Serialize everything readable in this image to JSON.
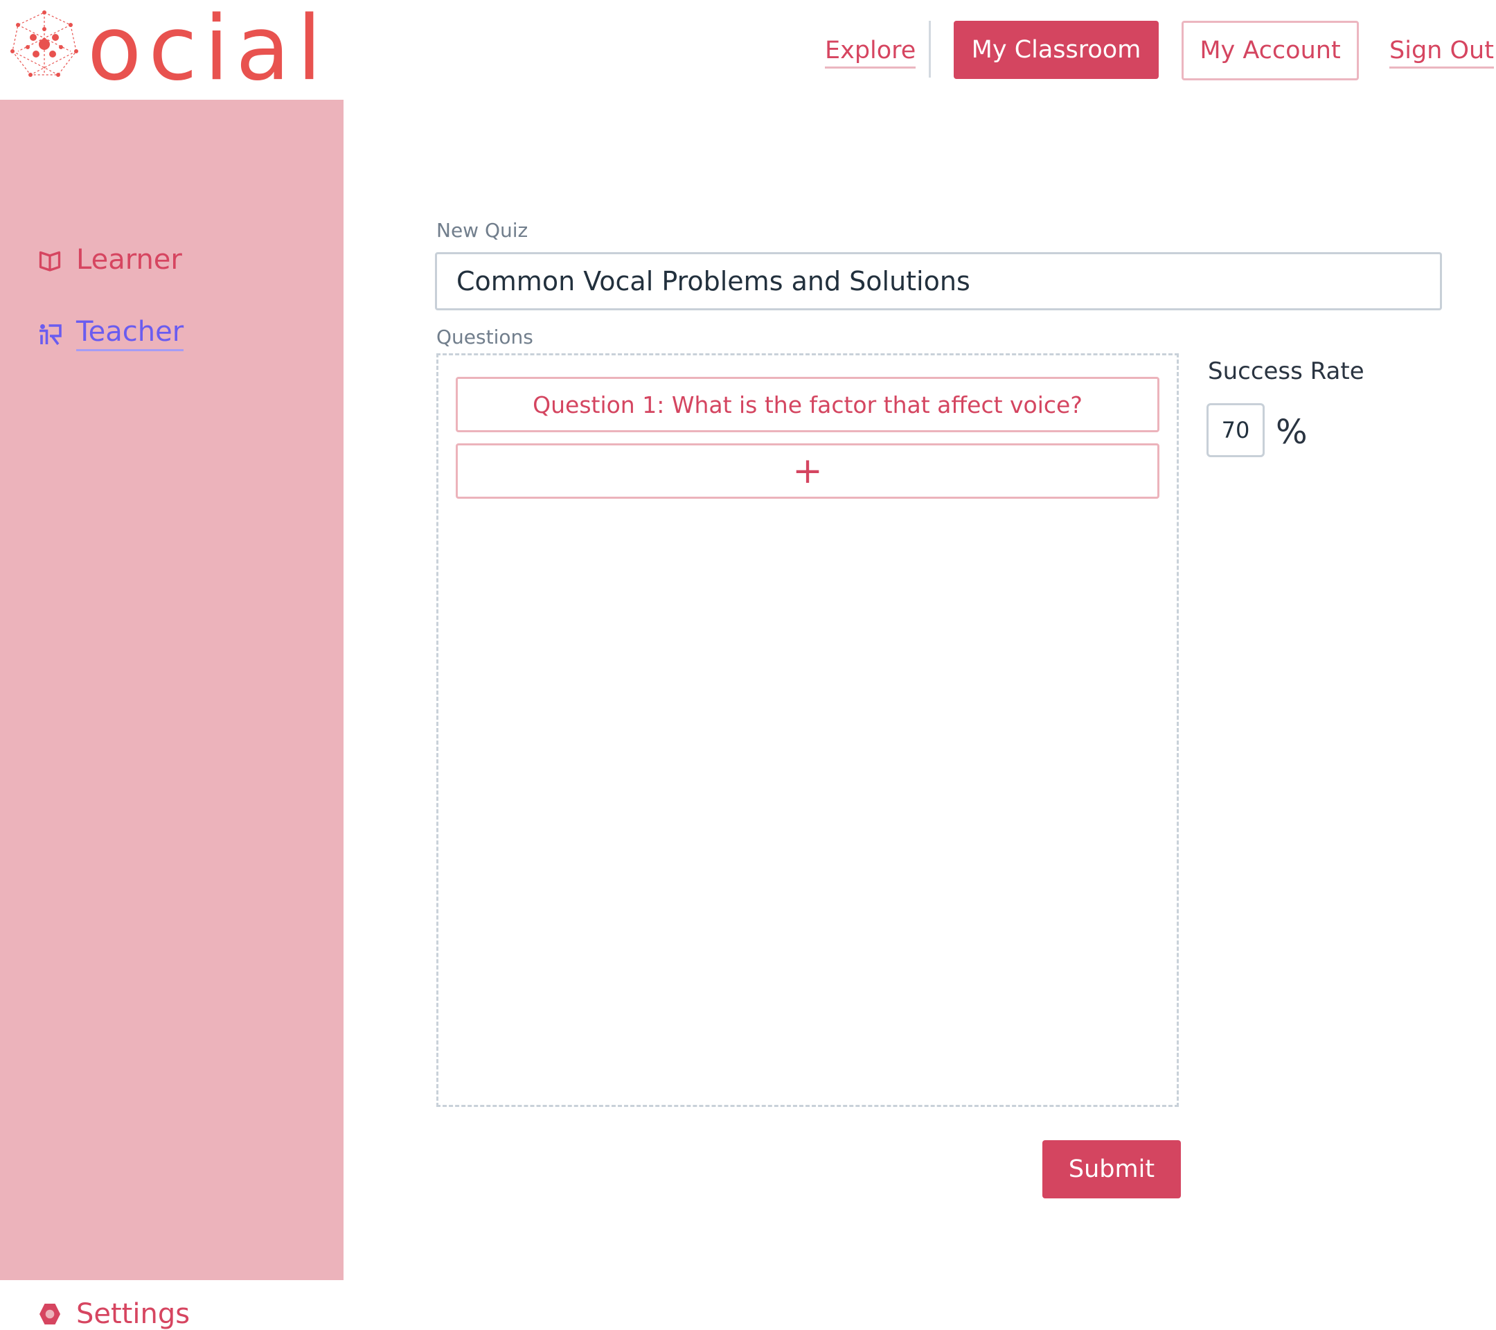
{
  "brand": {
    "logo_text": "ocial"
  },
  "nav": {
    "explore": "Explore",
    "my_classroom": "My Classroom",
    "my_account": "My Account",
    "sign_out": "Sign Out"
  },
  "sidebar": {
    "items": [
      {
        "label": "Learner",
        "icon": "book-icon"
      },
      {
        "label": "Teacher",
        "icon": "teacher-board-icon",
        "active": true
      }
    ],
    "settings": {
      "label": "Settings",
      "icon": "hexagon-gear-icon"
    }
  },
  "form": {
    "new_quiz_label": "New Quiz",
    "quiz_title_value": "Common Vocal Problems and Solutions",
    "questions_label": "Questions",
    "questions": [
      {
        "label": "Question 1: What is the factor that affect voice?"
      }
    ],
    "add_question_label": "+",
    "success_rate_label": "Success Rate",
    "success_rate_value": "70",
    "success_rate_unit": "%",
    "submit_label": "Submit"
  },
  "colors": {
    "accent": "#d44560",
    "sidebar_bg": "#ecb3bb",
    "active_nav": "#6a5cf0",
    "logo": "#e8524f"
  }
}
